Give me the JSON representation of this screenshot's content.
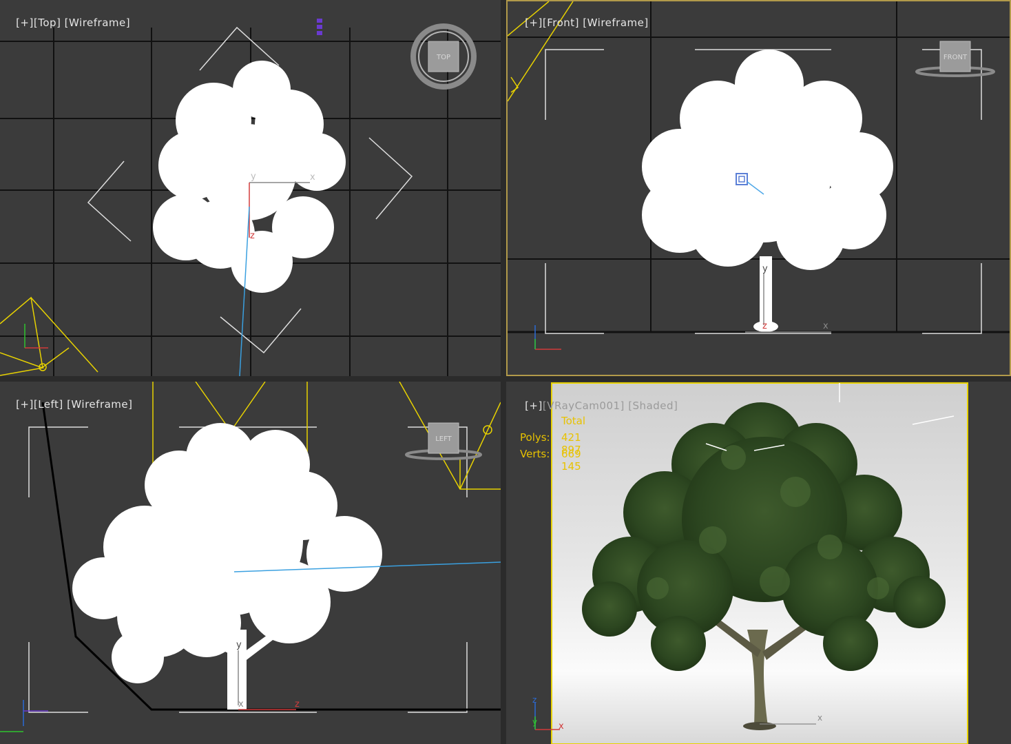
{
  "viewports": {
    "top": {
      "menu": "[+]",
      "view": "[Top]",
      "mode": "[Wireframe]",
      "navcube": "TOP",
      "gizmo": {
        "x": "x",
        "y": "y",
        "z": "z"
      }
    },
    "front": {
      "menu": "[+]",
      "view": "[Front]",
      "mode": "[Wireframe]",
      "navcube": "FRONT",
      "gizmo": {
        "x": "x",
        "y": "y",
        "z": "z"
      }
    },
    "left": {
      "menu": "[+]",
      "view": "[Left]",
      "mode": "[Wireframe]",
      "navcube": "LEFT",
      "gizmo": {
        "x": "x",
        "y": "y",
        "z": "z"
      }
    },
    "camera": {
      "menu": "[+]",
      "view": "[VRayCam001]",
      "mode": "[Shaded]",
      "gizmo": {
        "x": "x",
        "y": "y",
        "z": "z"
      },
      "stats": {
        "header": "Total",
        "polys_label": "Polys:",
        "polys_value": "421 897",
        "verts_label": "Verts:",
        "verts_value": "669 145"
      }
    }
  },
  "colors": {
    "viewport_bg": "#3b3b3b",
    "grid": "#111111",
    "active_border": "#b29a4a",
    "camera_frame": "#e8d200",
    "stats_text": "#e8c200",
    "foliage": "#2f4a22"
  },
  "icons": {
    "navcube_top": "navcube-icon",
    "navcube_front": "navcube-icon",
    "navcube_left": "navcube-icon",
    "camera": "camera-icon",
    "light_target": "light-icon"
  }
}
